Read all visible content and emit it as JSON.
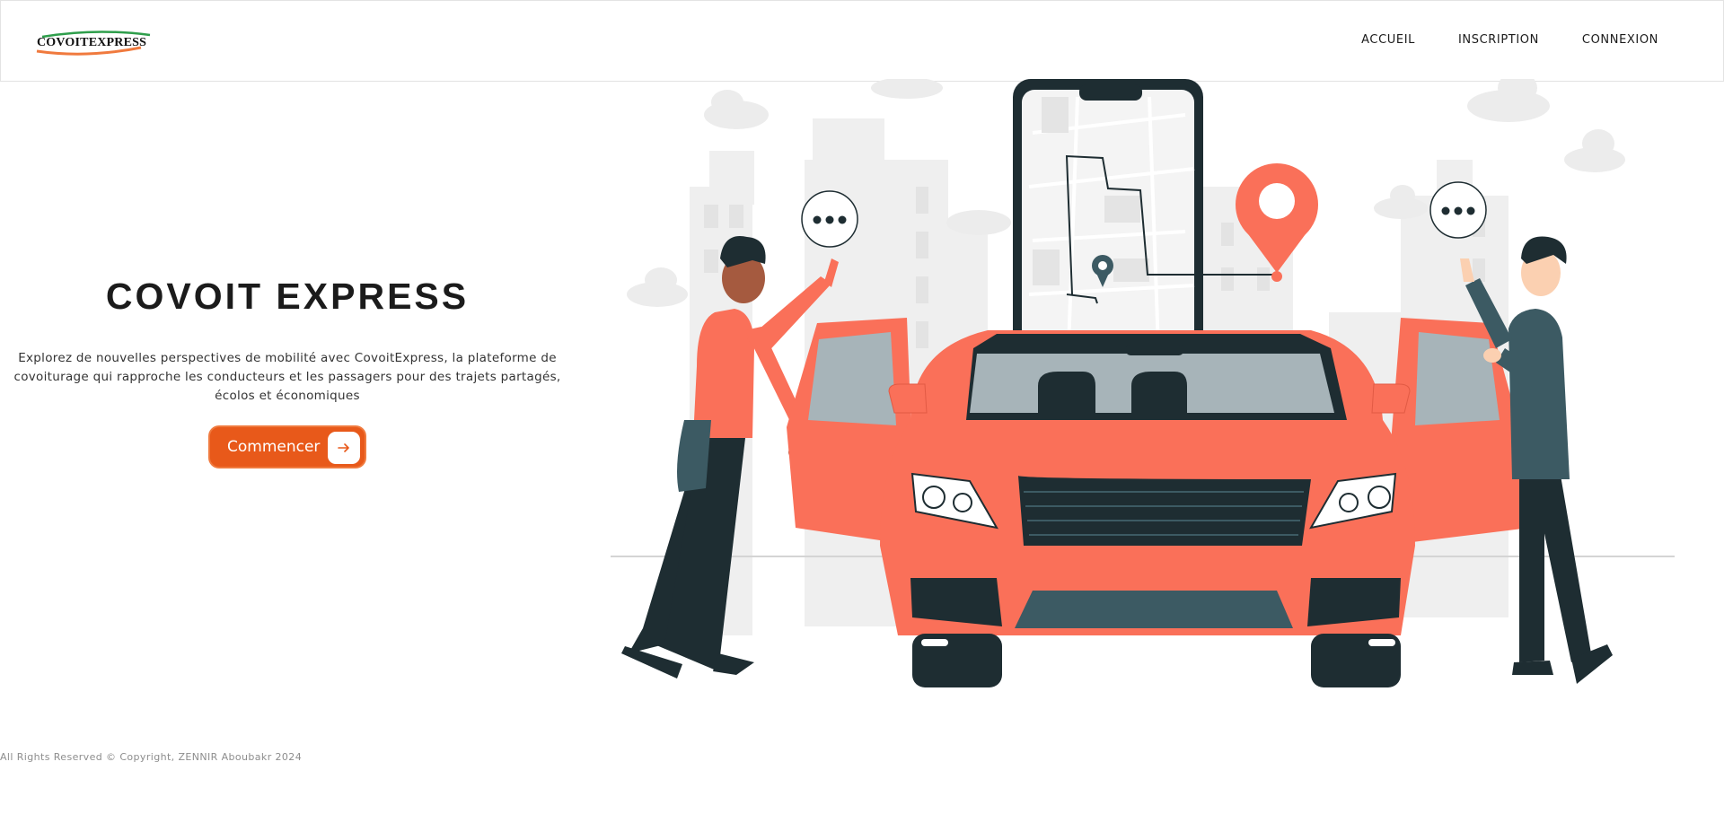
{
  "header": {
    "logo_text": "COVOITEXPRESS",
    "nav": [
      {
        "label": "ACCUEIL"
      },
      {
        "label": "INSCRIPTION"
      },
      {
        "label": "CONNEXION"
      }
    ]
  },
  "hero": {
    "title": "COVOIT EXPRESS",
    "description": "Explorez de nouvelles perspectives de mobilité avec CovoitExpress, la plateforme de covoiturage qui rapproche les conducteurs et les passagers pour des trajets partagés, écolos et économiques",
    "cta_label": "Commencer"
  },
  "footer": {
    "text": "All Rights Reserved © Copyright, ZENNIR Aboubakr 2024"
  },
  "icons": {
    "cta": "arrow-right-icon",
    "map": "location-pin-icon"
  },
  "colors": {
    "accent": "#e8591a",
    "car": "#fa7059",
    "dark": "#1e2d32"
  }
}
